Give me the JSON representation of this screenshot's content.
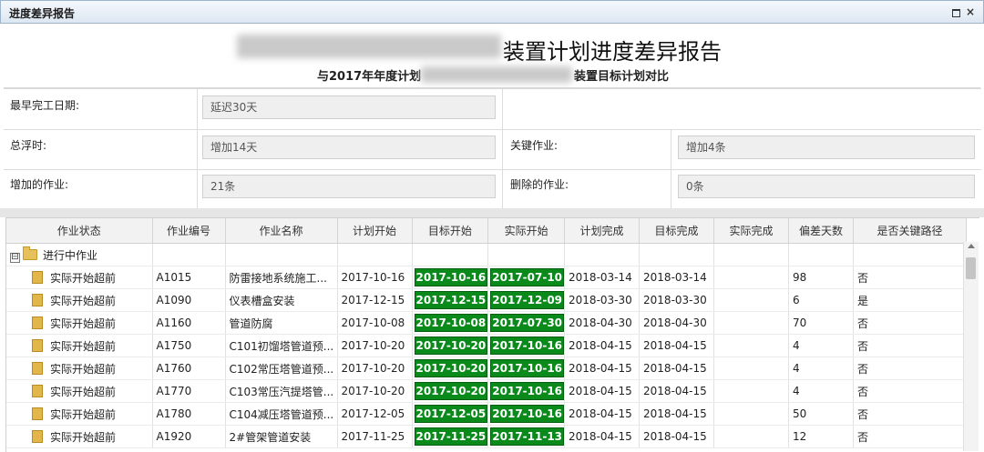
{
  "window": {
    "title": "进度差异报告"
  },
  "report": {
    "title": "装置计划进度差异报告",
    "subtitle_left": "与2017年年度计划",
    "subtitle_right": "装置目标计划对比"
  },
  "summary": {
    "finish_label": "最早完工日期:",
    "finish_value": "延迟30天",
    "float_label": "总浮时:",
    "float_value": "增加14天",
    "critical_label": "关键作业:",
    "critical_value": "增加4条",
    "added_label": "增加的作业:",
    "added_value": "21条",
    "deleted_label": "删除的作业:",
    "deleted_value": "0条"
  },
  "grid": {
    "columns": [
      "作业状态",
      "作业编号",
      "作业名称",
      "计划开始",
      "目标开始",
      "实际开始",
      "计划完成",
      "目标完成",
      "实际完成",
      "偏差天数",
      "是否关键路径"
    ],
    "group": {
      "label": "进行中作业",
      "expander": "⊟"
    },
    "rows": [
      {
        "status": "实际开始超前",
        "id": "A1015",
        "name": "防雷接地系统施工...",
        "plan_start": "2017-10-16",
        "target_start": "2017-10-16",
        "actual_start": "2017-07-10",
        "plan_finish": "2018-03-14",
        "target_finish": "2018-03-14",
        "actual_finish": "",
        "variance": "98",
        "critical": "否"
      },
      {
        "status": "实际开始超前",
        "id": "A1090",
        "name": "仪表槽盒安装",
        "plan_start": "2017-12-15",
        "target_start": "2017-12-15",
        "actual_start": "2017-12-09",
        "plan_finish": "2018-03-30",
        "target_finish": "2018-03-30",
        "actual_finish": "",
        "variance": "6",
        "critical": "是"
      },
      {
        "status": "实际开始超前",
        "id": "A1160",
        "name": "管道防腐",
        "plan_start": "2017-10-08",
        "target_start": "2017-10-08",
        "actual_start": "2017-07-30",
        "plan_finish": "2018-04-30",
        "target_finish": "2018-04-30",
        "actual_finish": "",
        "variance": "70",
        "critical": "否"
      },
      {
        "status": "实际开始超前",
        "id": "A1750",
        "name": "C101初馏塔管道预...",
        "plan_start": "2017-10-20",
        "target_start": "2017-10-20",
        "actual_start": "2017-10-16",
        "plan_finish": "2018-04-15",
        "target_finish": "2018-04-15",
        "actual_finish": "",
        "variance": "4",
        "critical": "否"
      },
      {
        "status": "实际开始超前",
        "id": "A1760",
        "name": "C102常压塔管道预...",
        "plan_start": "2017-10-20",
        "target_start": "2017-10-20",
        "actual_start": "2017-10-16",
        "plan_finish": "2018-04-15",
        "target_finish": "2018-04-15",
        "actual_finish": "",
        "variance": "4",
        "critical": "否"
      },
      {
        "status": "实际开始超前",
        "id": "A1770",
        "name": "C103常压汽提塔管...",
        "plan_start": "2017-10-20",
        "target_start": "2017-10-20",
        "actual_start": "2017-10-16",
        "plan_finish": "2018-04-15",
        "target_finish": "2018-04-15",
        "actual_finish": "",
        "variance": "4",
        "critical": "否"
      },
      {
        "status": "实际开始超前",
        "id": "A1780",
        "name": "C104减压塔管道预...",
        "plan_start": "2017-12-05",
        "target_start": "2017-12-05",
        "actual_start": "2017-10-16",
        "plan_finish": "2018-04-15",
        "target_finish": "2018-04-15",
        "actual_finish": "",
        "variance": "50",
        "critical": "否"
      },
      {
        "status": "实际开始超前",
        "id": "A1920",
        "name": "2#管架管道安装",
        "plan_start": "2017-11-25",
        "target_start": "2017-11-25",
        "actual_start": "2017-11-13",
        "plan_finish": "2018-04-15",
        "target_finish": "2018-04-15",
        "actual_finish": "",
        "variance": "12",
        "critical": "否"
      }
    ]
  },
  "colors": {
    "highlight_green": "#0b8a1c",
    "titlebar": "#dde7f2"
  },
  "icons": {
    "maximize": "maximize-icon",
    "close": "close-icon",
    "folder": "folder-icon",
    "row": "document-icon"
  }
}
